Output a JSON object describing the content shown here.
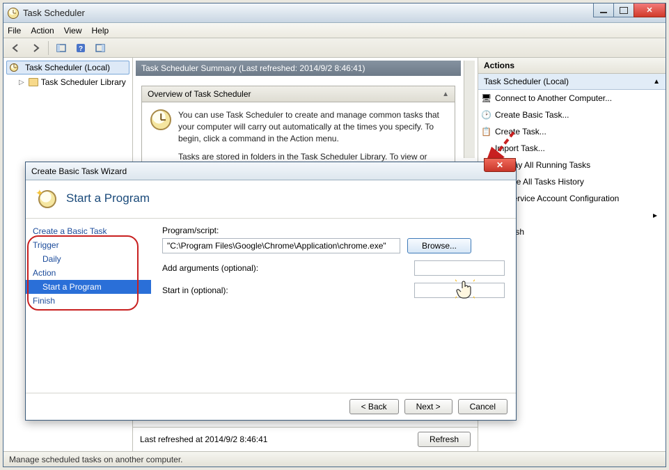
{
  "app": {
    "title": "Task Scheduler"
  },
  "menu": {
    "file": "File",
    "action": "Action",
    "view": "View",
    "help": "Help"
  },
  "tree": {
    "root": "Task Scheduler (Local)",
    "library": "Task Scheduler Library"
  },
  "summary": {
    "header": "Task Scheduler Summary (Last refreshed: 2014/9/2 8:46:41)",
    "overview_title": "Overview of Task Scheduler",
    "overview_p1": "You can use Task Scheduler to create and manage common tasks that your computer will carry out automatically at the times you specify. To begin, click a command in the Action menu.",
    "overview_p2": "Tasks are stored in folders in the Task Scheduler Library. To view or"
  },
  "footer": {
    "last_refreshed": "Last refreshed at 2014/9/2 8:46:41",
    "refresh": "Refresh"
  },
  "actions": {
    "header": "Actions",
    "sub": "Task Scheduler (Local)",
    "items": [
      "Connect to Another Computer...",
      "Create Basic Task...",
      "Create Task...",
      "Import Task...",
      "Display All Running Tasks",
      "Enable All Tasks History",
      "AT Service Account Configuration",
      "Refresh"
    ]
  },
  "statusbar": "Manage scheduled tasks on another computer.",
  "wizard": {
    "title": "Create Basic Task Wizard",
    "heading": "Start a Program",
    "nav": {
      "create": "Create a Basic Task",
      "trigger": "Trigger",
      "daily": "Daily",
      "action": "Action",
      "start_program": "Start a Program",
      "finish": "Finish"
    },
    "form": {
      "program_label": "Program/script:",
      "program_value": "\"C:\\Program Files\\Google\\Chrome\\Application\\chrome.exe\"",
      "browse": "Browse...",
      "args_label": "Add arguments (optional):",
      "args_value": "",
      "startin_label": "Start in (optional):",
      "startin_value": ""
    },
    "buttons": {
      "back": "< Back",
      "next": "Next >",
      "cancel": "Cancel"
    }
  }
}
